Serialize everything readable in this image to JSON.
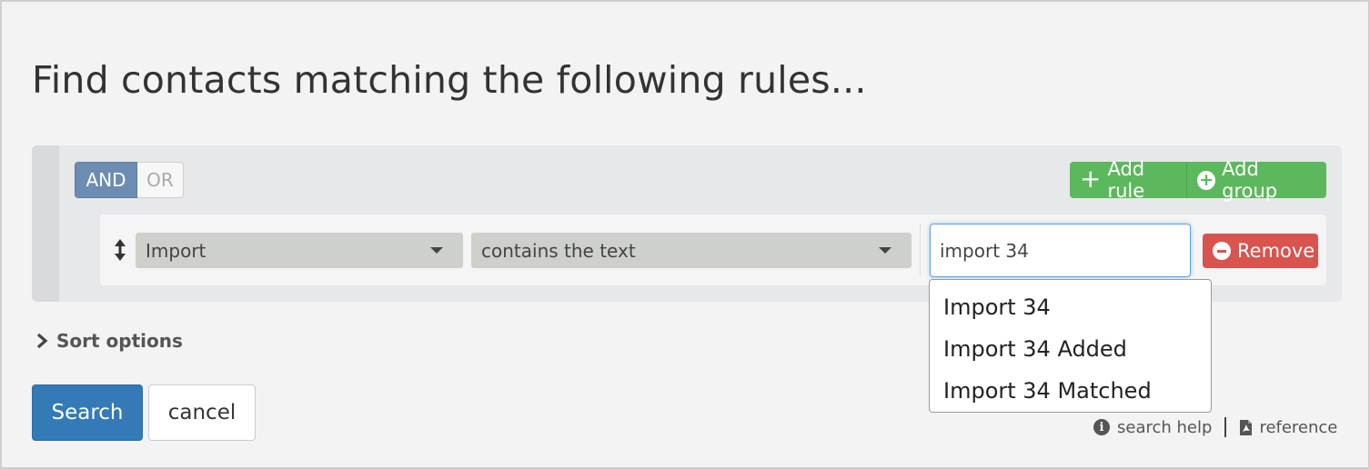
{
  "title": "Find contacts matching the following rules...",
  "logic": {
    "and_label": "AND",
    "or_label": "OR",
    "selected": "AND"
  },
  "actions": {
    "add_rule_label": "Add rule",
    "add_group_label": "Add group"
  },
  "rule": {
    "field": "Import",
    "operator": "contains the text",
    "value": "import 34",
    "remove_label": "Remove"
  },
  "autocomplete": [
    "Import 34",
    "Import 34 Added",
    "Import 34 Matched"
  ],
  "sort": {
    "label": "Sort options"
  },
  "buttons": {
    "search": "Search",
    "cancel": "cancel"
  },
  "help": {
    "search_help": "search help",
    "reference": "reference"
  },
  "colors": {
    "and_active": "#6d8cb1",
    "add_green": "#5cb85c",
    "remove_red": "#d9534f",
    "search_blue": "#337ab7"
  }
}
